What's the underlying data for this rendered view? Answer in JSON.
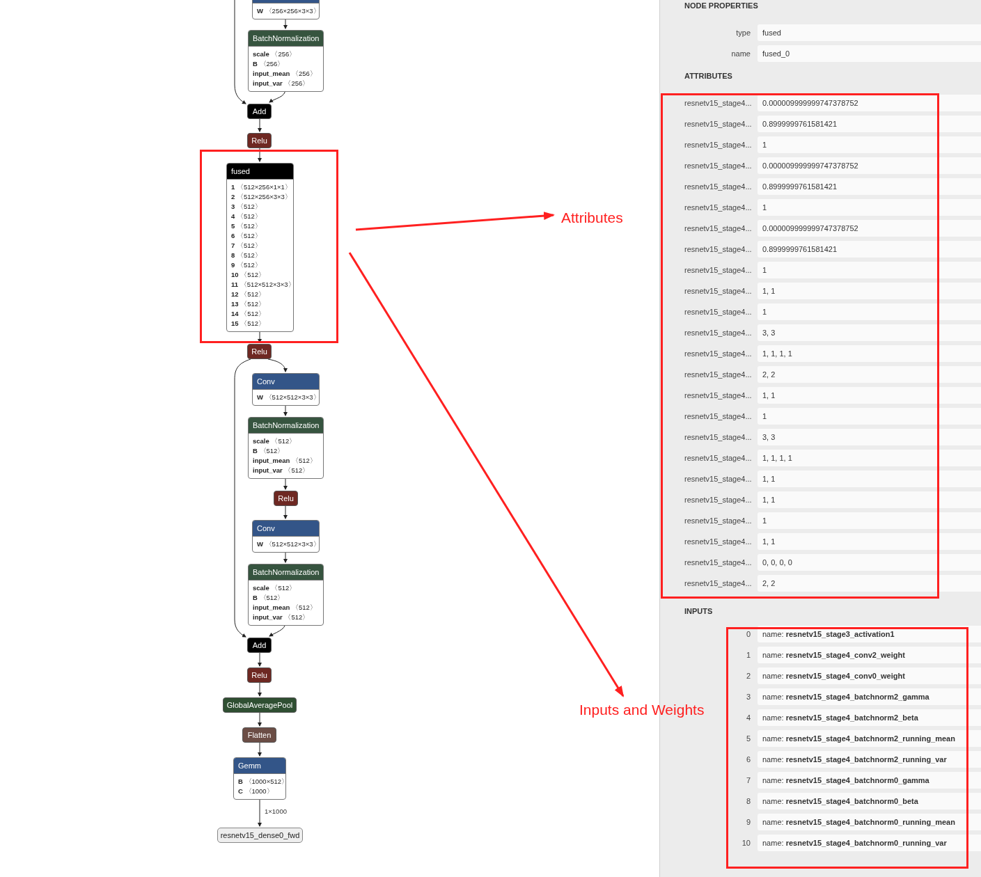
{
  "graph": {
    "nodes": [
      {
        "kind": "block",
        "color": "#335588",
        "attributes": [
          {
            "name": "W",
            "shape": "〈256×256×3×3〉"
          }
        ]
      },
      {
        "kind": "block",
        "label": "BatchNormalization",
        "color": "#36543f",
        "attributes": [
          {
            "name": "scale",
            "shape": "〈256〉"
          },
          {
            "name": "B",
            "shape": "〈256〉"
          },
          {
            "name": "input_mean",
            "shape": "〈256〉"
          },
          {
            "name": "input_var",
            "shape": "〈256〉"
          }
        ]
      },
      {
        "kind": "op",
        "label": "Add",
        "color": "#000000"
      },
      {
        "kind": "op",
        "label": "Relu",
        "color": "#6e2822"
      },
      {
        "kind": "block",
        "label": "fused",
        "color": "#000000",
        "attributes": [
          {
            "name": "1",
            "shape": "〈512×256×1×1〉"
          },
          {
            "name": "2",
            "shape": "〈512×256×3×3〉"
          },
          {
            "name": "3",
            "shape": "〈512〉"
          },
          {
            "name": "4",
            "shape": "〈512〉"
          },
          {
            "name": "5",
            "shape": "〈512〉"
          },
          {
            "name": "6",
            "shape": "〈512〉"
          },
          {
            "name": "7",
            "shape": "〈512〉"
          },
          {
            "name": "8",
            "shape": "〈512〉"
          },
          {
            "name": "9",
            "shape": "〈512〉"
          },
          {
            "name": "10",
            "shape": "〈512〉"
          },
          {
            "name": "11",
            "shape": "〈512×512×3×3〉"
          },
          {
            "name": "12",
            "shape": "〈512〉"
          },
          {
            "name": "13",
            "shape": "〈512〉"
          },
          {
            "name": "14",
            "shape": "〈512〉"
          },
          {
            "name": "15",
            "shape": "〈512〉"
          }
        ]
      },
      {
        "kind": "op",
        "label": "Relu",
        "color": "#6e2822"
      },
      {
        "kind": "block",
        "label": "Conv",
        "color": "#335588",
        "attributes": [
          {
            "name": "W",
            "shape": "〈512×512×3×3〉"
          }
        ]
      },
      {
        "kind": "block",
        "label": "BatchNormalization",
        "color": "#36543f",
        "attributes": [
          {
            "name": "scale",
            "shape": "〈512〉"
          },
          {
            "name": "B",
            "shape": "〈512〉"
          },
          {
            "name": "input_mean",
            "shape": "〈512〉"
          },
          {
            "name": "input_var",
            "shape": "〈512〉"
          }
        ]
      },
      {
        "kind": "op",
        "label": "Relu",
        "color": "#6e2822"
      },
      {
        "kind": "block",
        "label": "Conv",
        "color": "#335588",
        "attributes": [
          {
            "name": "W",
            "shape": "〈512×512×3×3〉"
          }
        ]
      },
      {
        "kind": "block",
        "label": "BatchNormalization",
        "color": "#36543f",
        "attributes": [
          {
            "name": "scale",
            "shape": "〈512〉"
          },
          {
            "name": "B",
            "shape": "〈512〉"
          },
          {
            "name": "input_mean",
            "shape": "〈512〉"
          },
          {
            "name": "input_var",
            "shape": "〈512〉"
          }
        ]
      },
      {
        "kind": "op",
        "label": "Add",
        "color": "#000000"
      },
      {
        "kind": "op",
        "label": "Relu",
        "color": "#6e2822"
      },
      {
        "kind": "op",
        "label": "GlobalAveragePool",
        "color": "#2f4f32"
      },
      {
        "kind": "op",
        "label": "Flatten",
        "color": "#6b4d45"
      },
      {
        "kind": "block",
        "label": "Gemm",
        "color": "#335588",
        "attributes": [
          {
            "name": "B",
            "shape": "〈1000×512〉"
          },
          {
            "name": "C",
            "shape": "〈1000〉"
          }
        ]
      }
    ],
    "edge_label": "1×1000",
    "output": "resnetv15_dense0_fwd"
  },
  "annotations": [
    {
      "label": "Attributes"
    },
    {
      "label": "Inputs and Weights"
    }
  ],
  "panel": {
    "title": "NODE PROPERTIES",
    "properties": [
      {
        "label": "type",
        "value": "fused"
      },
      {
        "label": "name",
        "value": "fused_0"
      }
    ],
    "attributes_title": "ATTRIBUTES",
    "attributes": [
      {
        "name": "resnetv15_stage4...",
        "value": "0.000009999999747378752"
      },
      {
        "name": "resnetv15_stage4...",
        "value": "0.8999999761581421"
      },
      {
        "name": "resnetv15_stage4...",
        "value": "1"
      },
      {
        "name": "resnetv15_stage4...",
        "value": "0.000009999999747378752"
      },
      {
        "name": "resnetv15_stage4...",
        "value": "0.8999999761581421"
      },
      {
        "name": "resnetv15_stage4...",
        "value": "1"
      },
      {
        "name": "resnetv15_stage4...",
        "value": "0.000009999999747378752"
      },
      {
        "name": "resnetv15_stage4...",
        "value": "0.8999999761581421"
      },
      {
        "name": "resnetv15_stage4...",
        "value": "1"
      },
      {
        "name": "resnetv15_stage4...",
        "value": "1, 1"
      },
      {
        "name": "resnetv15_stage4...",
        "value": "1"
      },
      {
        "name": "resnetv15_stage4...",
        "value": "3, 3"
      },
      {
        "name": "resnetv15_stage4...",
        "value": "1, 1, 1, 1"
      },
      {
        "name": "resnetv15_stage4...",
        "value": "2, 2"
      },
      {
        "name": "resnetv15_stage4...",
        "value": "1, 1"
      },
      {
        "name": "resnetv15_stage4...",
        "value": "1"
      },
      {
        "name": "resnetv15_stage4...",
        "value": "3, 3"
      },
      {
        "name": "resnetv15_stage4...",
        "value": "1, 1, 1, 1"
      },
      {
        "name": "resnetv15_stage4...",
        "value": "1, 1"
      },
      {
        "name": "resnetv15_stage4...",
        "value": "1, 1"
      },
      {
        "name": "resnetv15_stage4...",
        "value": "1"
      },
      {
        "name": "resnetv15_stage4...",
        "value": "1, 1"
      },
      {
        "name": "resnetv15_stage4...",
        "value": "0, 0, 0, 0"
      },
      {
        "name": "resnetv15_stage4...",
        "value": "2, 2"
      }
    ],
    "inputs_title": "INPUTS",
    "inputs": [
      {
        "index": "0",
        "value": "name: **resnetv15_stage3_activation1**"
      },
      {
        "index": "1",
        "value": "name: **resnetv15_stage4_conv2_weight**"
      },
      {
        "index": "2",
        "value": "name: **resnetv15_stage4_conv0_weight**"
      },
      {
        "index": "3",
        "value": "name: **resnetv15_stage4_batchnorm2_gamma**"
      },
      {
        "index": "4",
        "value": "name: **resnetv15_stage4_batchnorm2_beta**"
      },
      {
        "index": "5",
        "value": "name: **resnetv15_stage4_batchnorm2_running_mean**"
      },
      {
        "index": "6",
        "value": "name: **resnetv15_stage4_batchnorm2_running_var**"
      },
      {
        "index": "7",
        "value": "name: **resnetv15_stage4_batchnorm0_gamma**"
      },
      {
        "index": "8",
        "value": "name: **resnetv15_stage4_batchnorm0_beta**"
      },
      {
        "index": "9",
        "value": "name: **resnetv15_stage4_batchnorm0_running_mean**"
      },
      {
        "index": "10",
        "value": "name: **resnetv15_stage4_batchnorm0_running_var**"
      }
    ]
  }
}
